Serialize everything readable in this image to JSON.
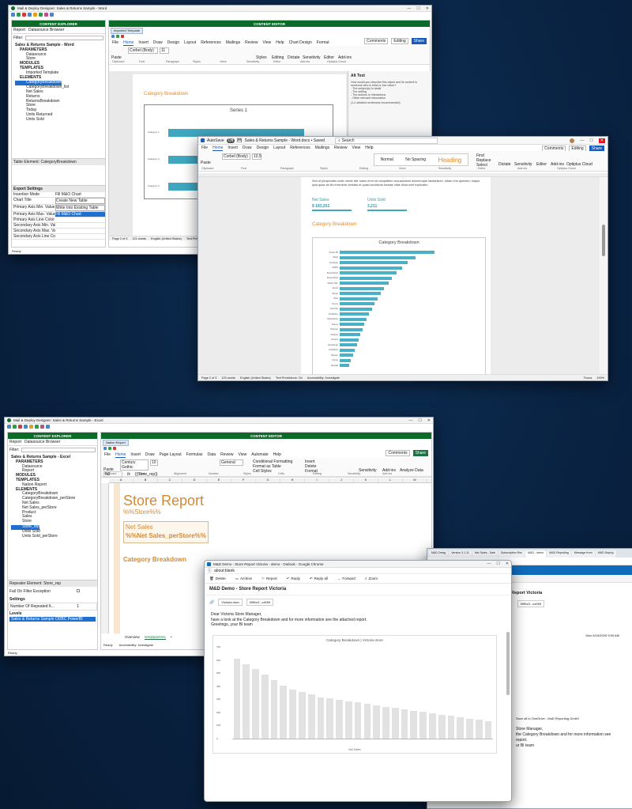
{
  "word_designer": {
    "title": "Mail & Deploy Designer: Sales & Returns Sample - Word",
    "content_explorer": "CONTENT EXPLORER",
    "content_editor": "CONTENT EDITOR",
    "tab_report": "Report",
    "tab_ds_browser": "Datasource Browser",
    "filter_label": "Filter:",
    "tree": {
      "root": "Sales & Returns Sample - Word",
      "parameters": "PARAMETERS",
      "p1": "Datasource",
      "p2": "Store",
      "modules": "MODULES",
      "templates": "TEMPLATES",
      "t1": "Imported Template",
      "elements": "ELEMENTS",
      "e1": "CategoryBreakdown",
      "e2": "CategoryBreakdown_list",
      "e3": "Net Sales",
      "e4": "Returns",
      "e5": "ReturnsBreakdown",
      "e6": "Store",
      "e7": "Today",
      "e8": "Units Returned",
      "e9": "Units Sold"
    },
    "table_element": "Table Element: CategoryBreakdown",
    "export_settings": "Export Settings",
    "settings": [
      {
        "k": "Insertion Mode",
        "v": "Fill M&O Chart"
      },
      {
        "k": "Chart Title",
        "v": "Create New Table"
      },
      {
        "k": "Primary Axis Min. Value",
        "v": "Write Into Existing Table"
      },
      {
        "k": "Primary Axis Max. Value",
        "v": "Fill M&O Chart"
      },
      {
        "k": "Primary Axis Line Color",
        "v": ""
      },
      {
        "k": "Secondary Axis Min. Val...",
        "v": ""
      },
      {
        "k": "Secondary Axis Max. Va...",
        "v": ""
      },
      {
        "k": "Secondary Axis Line Color",
        "v": ""
      }
    ],
    "editor_tab": "Imported Template",
    "ribbon_tabs": [
      "File",
      "Home",
      "Insert",
      "Draw",
      "Design",
      "Layout",
      "References",
      "Mailings",
      "Review",
      "View",
      "Help",
      "Chart Design",
      "Format"
    ],
    "comments": "Comments",
    "editing": "Editing",
    "share": "Share",
    "font": "Corbel (Body)",
    "font_size": "11",
    "groups": [
      "Clipboard",
      "Font",
      "Paragraph",
      "Styles",
      "Voice",
      "Sensitivity",
      "Editor",
      "Add-ins",
      "Optiplus Cloud"
    ],
    "btn_styles": "Styles",
    "btn_editing": "Editing",
    "btn_dictate": "Dictate",
    "btn_sensitivity": "Sensitivity",
    "btn_editor": "Editor",
    "btn_addins": "Add-ins",
    "btn_paste": "Paste",
    "heading": "Category Breakdown",
    "chart_title": "Series 1",
    "cats": [
      "Category 1",
      "Category 2",
      "Category 3"
    ],
    "alt_text_title": "Alt Text",
    "alt_text_body": "How would you describe this object and its context to someone who is blind or low vision?",
    "alt_list": [
      "- The subject(s) in detail",
      "- The setting",
      "- The actions or interactions",
      "- Other relevant information"
    ],
    "alt_note": "(1-2 detailed sentences recommended)",
    "status": [
      "Page 2 of 3",
      "121 words",
      "English (United States)",
      "Text Pre"
    ],
    "ready": "Ready"
  },
  "word_doc": {
    "autosave": "AutoSave",
    "autosave_state": "Off",
    "title": "Sales & Returns Sample - Word.docx • Saved",
    "search": "Search",
    "ribbon_tabs": [
      "File",
      "Home",
      "Insert",
      "Draw",
      "Design",
      "Layout",
      "References",
      "Mailings",
      "Review",
      "View",
      "Help"
    ],
    "comments": "Comments",
    "editing": "Editing",
    "share": "Share",
    "font": "Corbel (Body)",
    "font_size": "10,5",
    "styles": [
      "Normal",
      "No Spacing",
      "Heading"
    ],
    "find": "Find",
    "replace": "Replace",
    "select": "Select",
    "btn_dictate": "Dictate",
    "btn_sensitivity": "Sensitivity",
    "btn_editor": "Editor",
    "btn_addins": "Add-ins",
    "btn_optiplus": "Optiplus Cloud",
    "btn_paste": "Paste",
    "groups": [
      "Clipboard",
      "Font",
      "Paragraph",
      "Styles",
      "Editing",
      "Voice",
      "Sensitivity",
      "Editor",
      "Add-ins",
      "Optiplus Cloud"
    ],
    "lorem": "Sed ut perspiciatis unde omnis iste natus error sit voluptatem accusantium doloremque laudantium, totam rem aperiam, eaque ipsa quae ab illo inventore veritatis et quasi architecto beatae vitae dicta sunt explicabo.",
    "net_sales_label": "Net Sales",
    "net_sales_value": "$ 183,202",
    "units_label": "Units Sold",
    "units_value": "3,211",
    "heading": "Category Breakdown",
    "chart_title": "Category Breakdown",
    "status": [
      "Page 2 of 3",
      "120 words",
      "English (United States)",
      "Text Predictions: On",
      "Accessibility: Investigate"
    ],
    "focus": "Focus",
    "zoom": "100%"
  },
  "excel_designer": {
    "title": "Mail & Deploy Designer: Sales & Returns Sample - Excel",
    "content_explorer": "CONTENT EXPLORER",
    "content_editor": "CONTENT EDITOR",
    "tab_report": "Report",
    "tab_ds_browser": "Datasource Browser",
    "filter_label": "Filter:",
    "tree": {
      "root": "Sales & Returns Sample - Excel",
      "parameters": "PARAMETERS",
      "p1": "Datasource",
      "p2": "Report",
      "modules": "MODULES",
      "templates": "TEMPLATES",
      "t1": "Nation Report",
      "elements": "ELEMENTS",
      "e1": "CategoryBreakdown",
      "e2": "CategoryBreakdown_perStore",
      "e3": "Net Sales",
      "e4": "Net Sales_perStore",
      "e5": "Product",
      "e6": "Sales",
      "e7": "Store",
      "e8": "Store_rep",
      "e9": "Units Sold",
      "e10": "Units Sold_perStore"
    },
    "repeater": "Repeater Element: Store_rep",
    "fail_label": "Fail On Filter Exception",
    "settings_label": "Settings",
    "repeated_label": "Number Of Repeated It...",
    "repeated_value": "1",
    "levels_label": "Levels",
    "level_item": "Sales & Returns Sample ODBC PowerBI",
    "editor_tab": "Nation Report",
    "ribbon_tabs": [
      "File",
      "Home",
      "Insert",
      "Draw",
      "Page Layout",
      "Formulas",
      "Data",
      "Review",
      "View",
      "Automate",
      "Help"
    ],
    "comments": "Comments",
    "share": "Share",
    "font": "Century Gothic",
    "font_size": "10",
    "number_format": "General",
    "cond_fmt": "Conditional Formatting",
    "fmt_table": "Format as Table",
    "cell_styles": "Cell Styles",
    "insert": "Insert",
    "delete": "Delete",
    "format": "Format",
    "btn_sensitivity": "Sensitivity",
    "btn_addins": "Add-ins",
    "btn_analyze": "Analyze Data",
    "btn_paste": "Paste",
    "groups": [
      "Clipboard",
      "Font",
      "Alignment",
      "Number",
      "Styles",
      "Cells",
      "Editing",
      "Sensitivity",
      "Add-ins"
    ],
    "cell_ref": "N2",
    "formula": "{{Store_rep}}",
    "cols": [
      "A",
      "B",
      "C",
      "D",
      "E",
      "F",
      "G",
      "H",
      "I",
      "J",
      "K",
      "L",
      "M"
    ],
    "store_report": "Store Report",
    "store_field": "%%Store%%",
    "net_sales": "Net Sales",
    "net_sales_field": "%%Net Sales_perStore%%",
    "cat_breakdown": "Category Breakdown",
    "sheet_tabs": [
      "Overview",
      "%%Store%%"
    ],
    "status_ready": "Ready",
    "status_access": "Accessibility: Investigate",
    "ready": "Ready"
  },
  "chrome_bg": {
    "report_title": "Report Victoria",
    "attachment": "f9ffbc3...cd059",
    "save_all": "Save all to OneDrive - MaD Reporting GmbH",
    "date": "Mon 5/19/2025 9:59 AM",
    "lines": [
      "Store Manager,",
      "the Category Breakdown and for more information see",
      "report.",
      "ur BI team"
    ]
  },
  "outlook_popup": {
    "title": "M&D Demo - Store Report Victoria - demo - Outlook - Google Chrome",
    "url": "about:blank",
    "toolbar": [
      "Delete",
      "Archive",
      "Report",
      "Reply",
      "Reply all",
      "Forward",
      "Zoom"
    ],
    "subject": "M&D Demo - Store Report Victoria",
    "attach1": "Victoria.docx",
    "attach2": "f9ffbc3...cd059",
    "greeting": "Dear Victoria Store Manager,",
    "body": "have a look at the Category Breakdown and for more information see the attached report.",
    "sign": "Greetings, your BI team",
    "chart_title": "Category Breakdown | Victoria store",
    "yticks": [
      "700",
      "600",
      "500",
      "400",
      "300",
      "200",
      "100",
      "0"
    ],
    "xlabel": "Net Sales"
  },
  "tabs": [
    "M&D Desig",
    "Version 3.1.11",
    "Net Sales - Sale",
    "Subscription Rec",
    "M&D - demo",
    "M&D Reporting",
    "Message from",
    "M&D Deploy"
  ],
  "chart_data": [
    {
      "type": "bar",
      "title": "Series 1",
      "orientation": "horizontal",
      "categories": [
        "Category 1",
        "Category 2",
        "Category 3"
      ],
      "values": [
        4.3,
        2.5,
        3.5
      ]
    },
    {
      "type": "bar",
      "title": "Category Breakdown",
      "orientation": "horizontal",
      "categories": [
        "Power BI",
        "Word",
        "OneNote",
        "SSRS",
        "PowerPoint",
        "PowerApps",
        "SSAS Tab.",
        "Excel",
        "Skype",
        "Visio",
        "Forms",
        "Yammer",
        "Publisher",
        "SharePoint",
        "Teams",
        "Planner",
        "Outlook",
        "Access",
        "Exchange",
        "OneDrive",
        "Stream",
        "Intune",
        "Kaizala"
      ],
      "values": [
        100,
        80,
        72,
        66,
        60,
        55,
        52,
        47,
        43,
        40,
        37,
        34,
        31,
        28,
        26,
        24,
        22,
        20,
        18,
        16,
        14,
        12,
        10
      ]
    },
    {
      "type": "bar",
      "title": "Category Breakdown | Victoria store",
      "ylim": [
        0,
        700
      ],
      "xlabel": "Net Sales",
      "values": [
        600,
        560,
        520,
        480,
        440,
        400,
        370,
        350,
        330,
        310,
        300,
        290,
        280,
        270,
        260,
        250,
        240,
        230,
        220,
        210,
        200,
        190,
        180,
        170,
        160,
        150,
        140,
        130
      ]
    }
  ]
}
